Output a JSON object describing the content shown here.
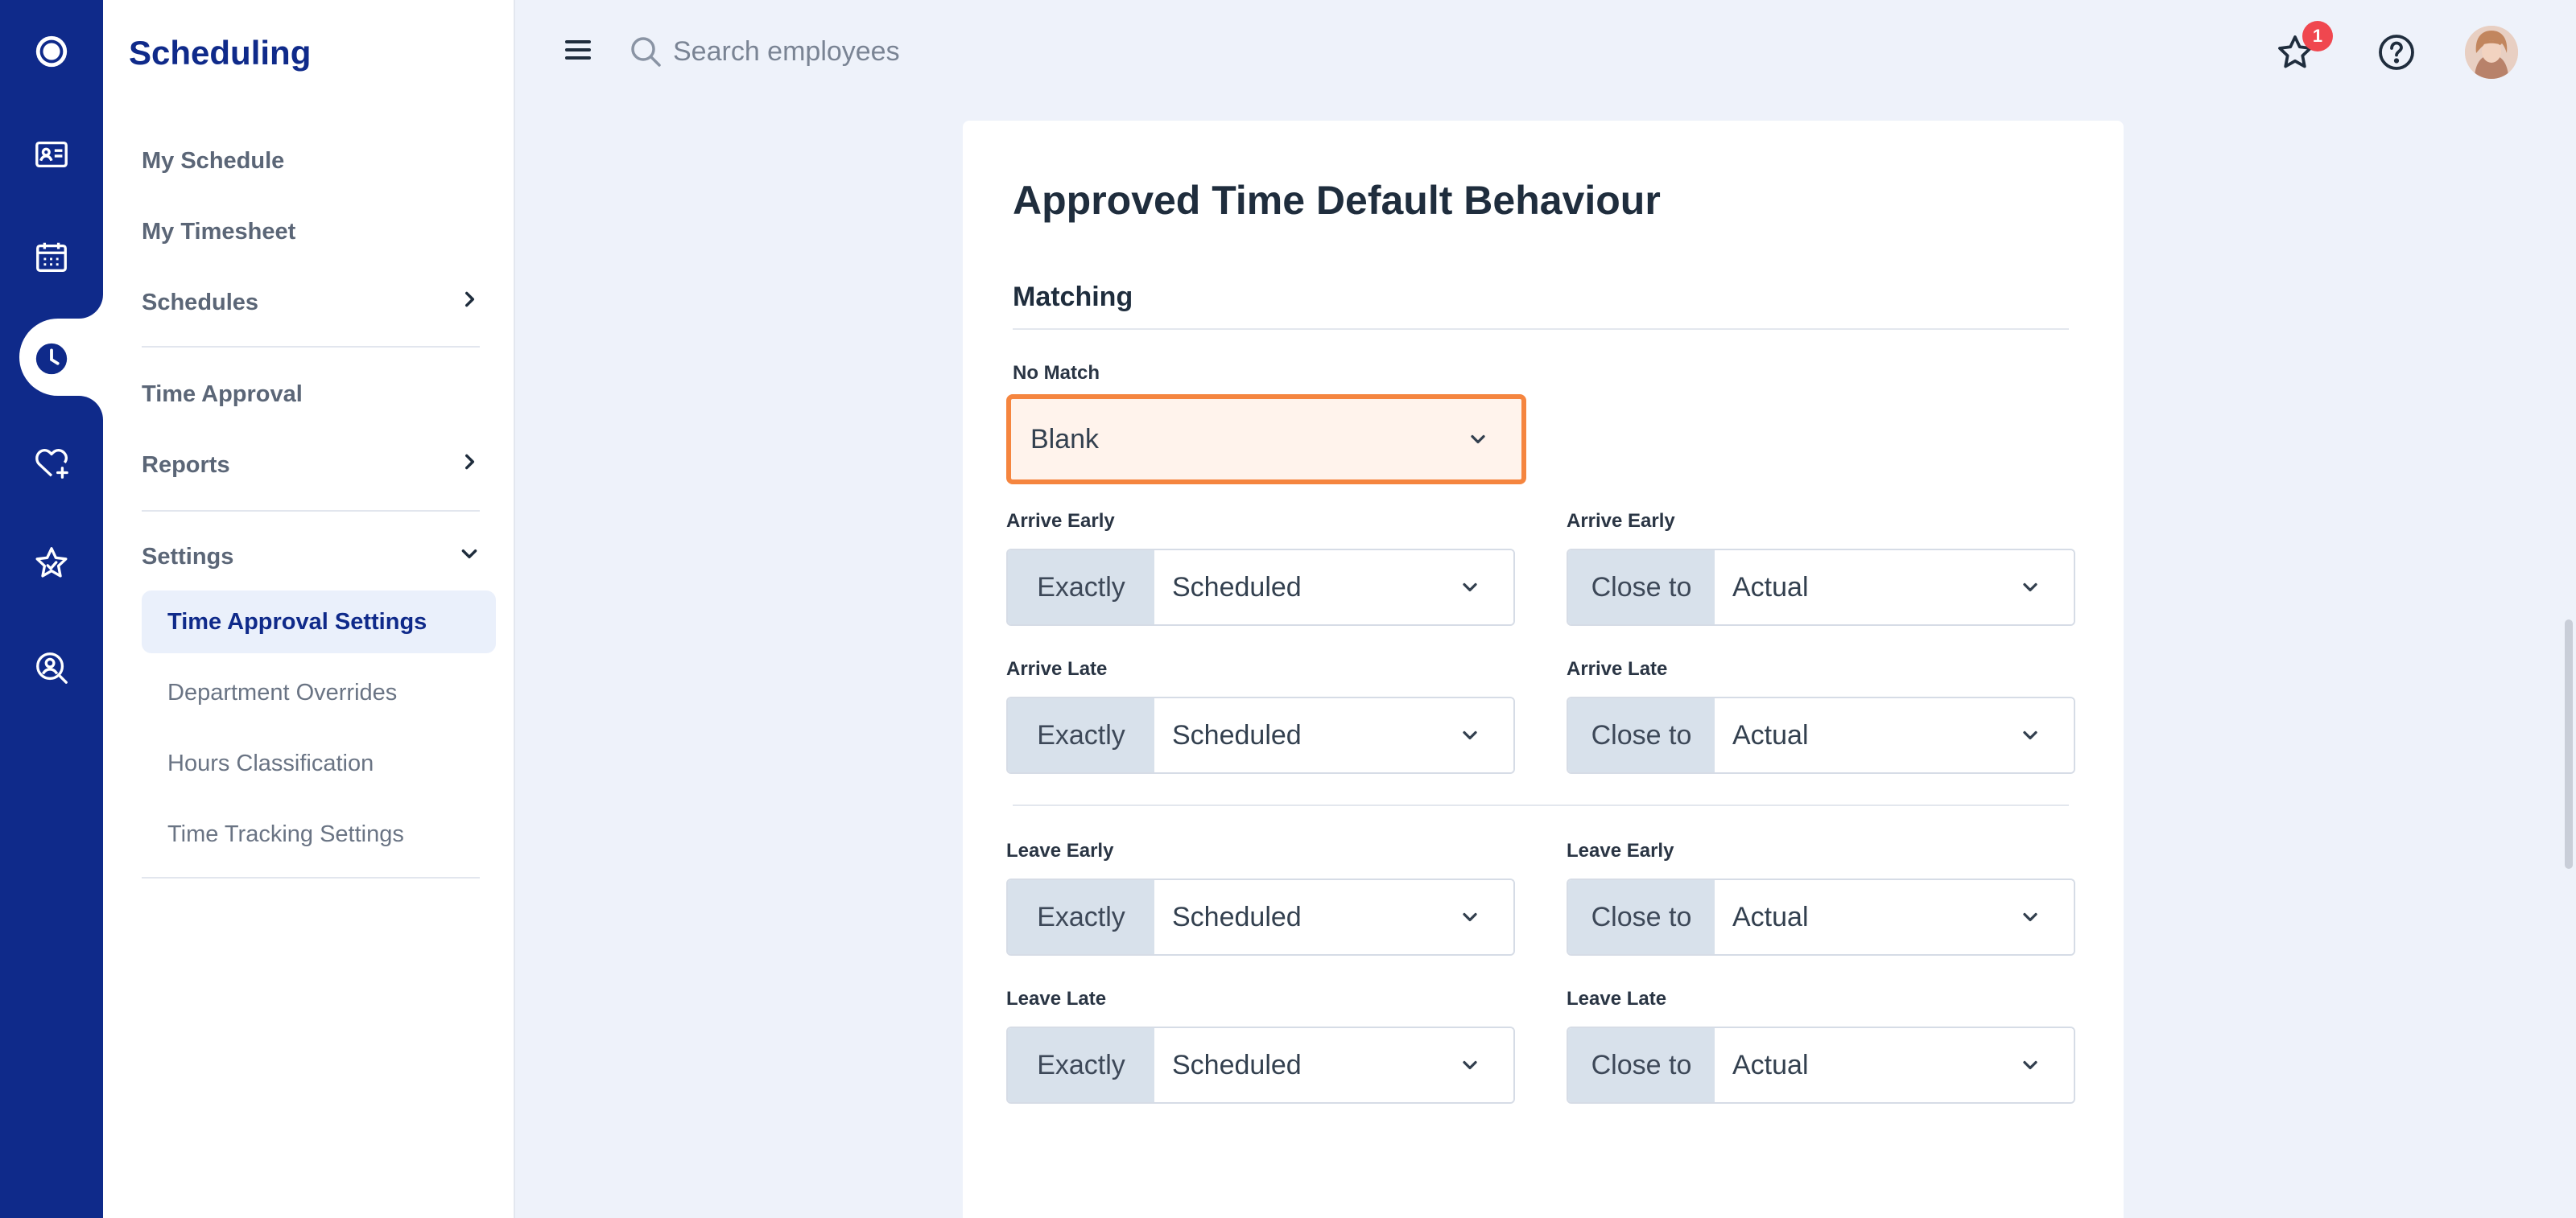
{
  "app": {
    "title": "Scheduling"
  },
  "colors": {
    "rail": "#0f2a8a",
    "accent": "#0f2a8a",
    "focus_border": "#f5853f",
    "badge": "#f0474f"
  },
  "rail": {
    "icons": [
      "logo-icon",
      "id-card-icon",
      "calendar-icon",
      "clock-icon",
      "heart-plus-icon",
      "star-icon",
      "search-person-icon"
    ]
  },
  "sidebar": {
    "items": [
      {
        "label": "My Schedule"
      },
      {
        "label": "My Timesheet"
      },
      {
        "label": "Schedules"
      },
      {
        "label": "Time Approval"
      },
      {
        "label": "Reports"
      },
      {
        "label": "Settings"
      }
    ],
    "settings_children": [
      {
        "label": "Time Approval Settings"
      },
      {
        "label": "Department Overrides"
      },
      {
        "label": "Hours Classification"
      },
      {
        "label": "Time Tracking Settings"
      }
    ]
  },
  "topbar": {
    "search_placeholder": "Search employees",
    "notification_count": "1"
  },
  "card": {
    "title": "Approved Time Default Behaviour",
    "section": "Matching",
    "no_match": {
      "label": "No Match",
      "value": "Blank"
    },
    "rows": [
      {
        "left": {
          "label": "Arrive Early",
          "prefix": "Exactly",
          "value": "Scheduled"
        },
        "right": {
          "label": "Arrive Early",
          "prefix": "Close to",
          "value": "Actual"
        }
      },
      {
        "left": {
          "label": "Arrive Late",
          "prefix": "Exactly",
          "value": "Scheduled"
        },
        "right": {
          "label": "Arrive Late",
          "prefix": "Close to",
          "value": "Actual"
        }
      },
      {
        "left": {
          "label": "Leave Early",
          "prefix": "Exactly",
          "value": "Scheduled"
        },
        "right": {
          "label": "Leave Early",
          "prefix": "Close to",
          "value": "Actual"
        }
      },
      {
        "left": {
          "label": "Leave Late",
          "prefix": "Exactly",
          "value": "Scheduled"
        },
        "right": {
          "label": "Leave Late",
          "prefix": "Close to",
          "value": "Actual"
        }
      }
    ]
  }
}
